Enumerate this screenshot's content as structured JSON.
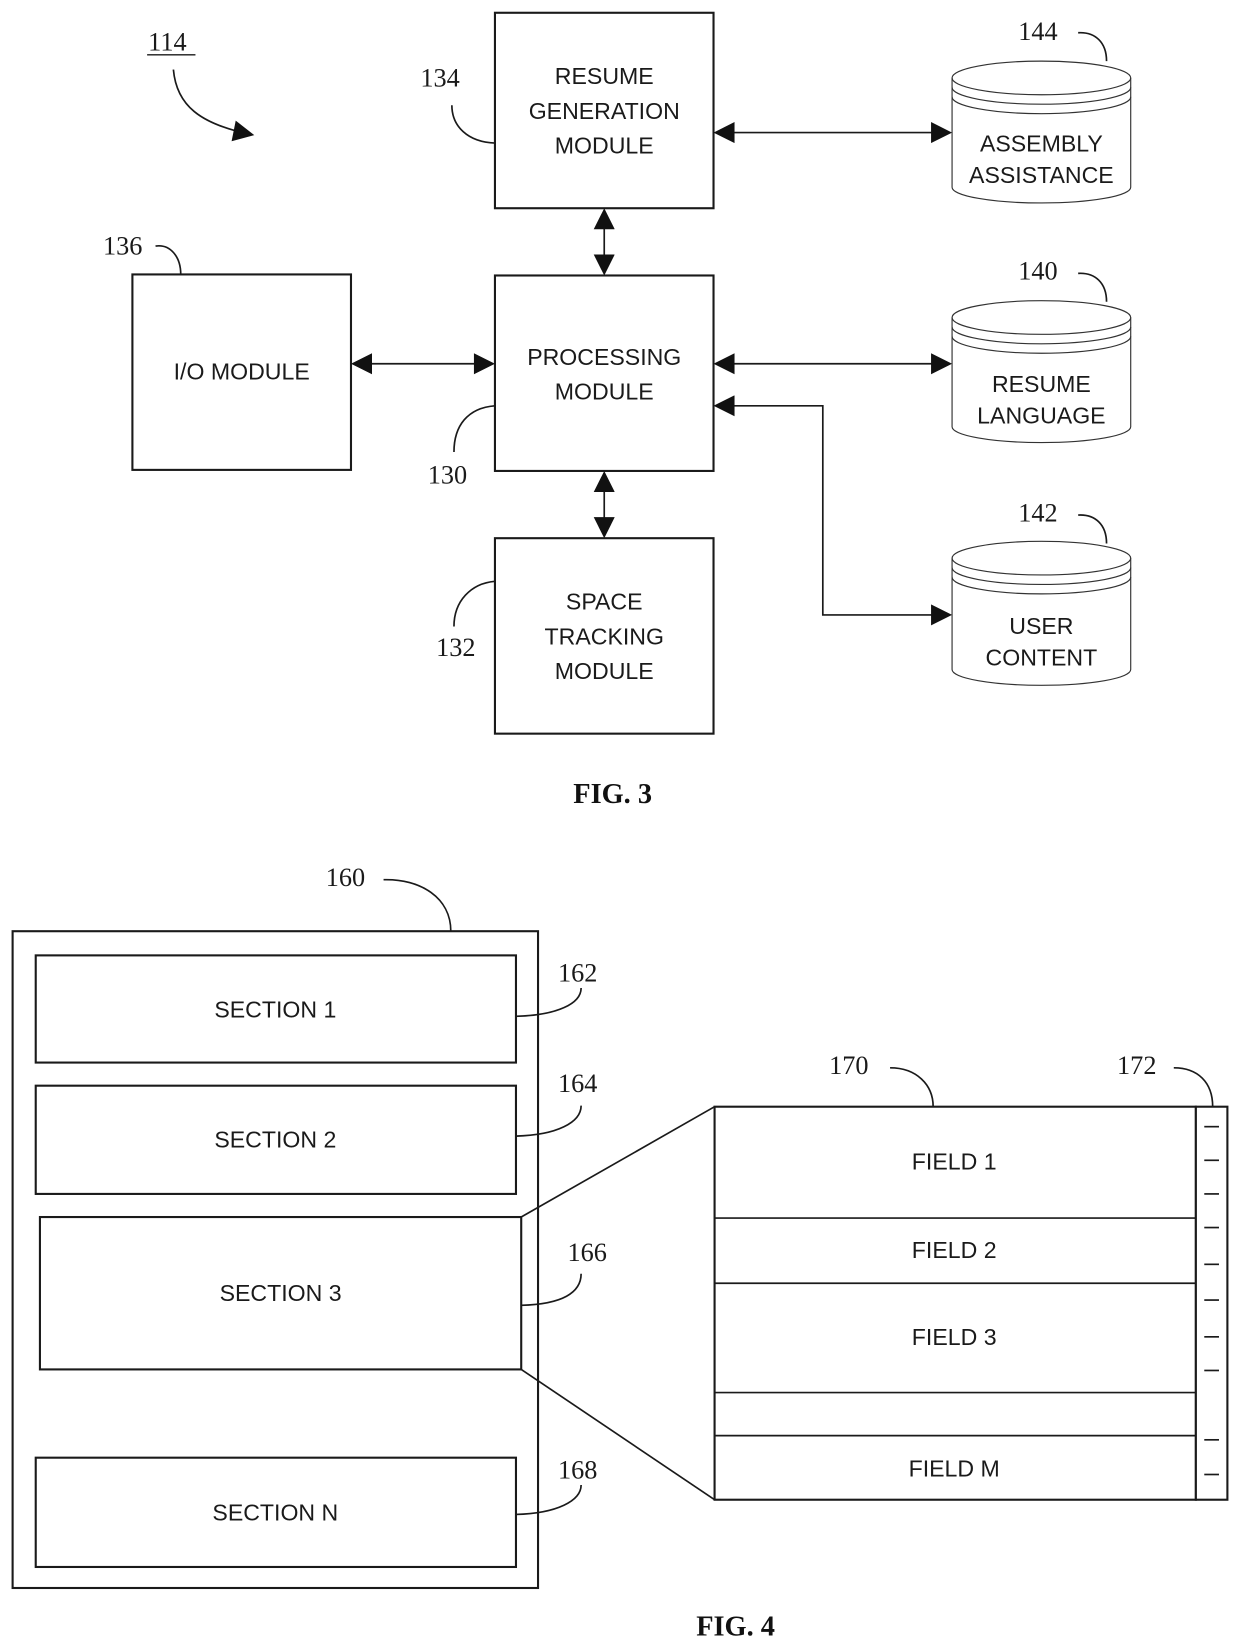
{
  "fig3": {
    "caption": "FIG. 3",
    "system_ref": "114",
    "modules": {
      "resume_generation": {
        "ref": "134",
        "lines": [
          "RESUME",
          "GENERATION",
          "MODULE"
        ]
      },
      "io": {
        "ref": "136",
        "lines": [
          "I/O MODULE"
        ]
      },
      "processing": {
        "ref": "130",
        "lines": [
          "PROCESSING",
          "MODULE"
        ]
      },
      "space_tracking": {
        "ref": "132",
        "lines": [
          "SPACE",
          "TRACKING",
          "MODULE"
        ]
      }
    },
    "databases": {
      "assembly_assistance": {
        "ref": "144",
        "lines": [
          "ASSEMBLY",
          "ASSISTANCE"
        ]
      },
      "resume_language": {
        "ref": "140",
        "lines": [
          "RESUME",
          "LANGUAGE"
        ]
      },
      "user_content": {
        "ref": "142",
        "lines": [
          "USER",
          "CONTENT"
        ]
      }
    },
    "connections": [
      {
        "from": "resume_generation",
        "to": "assembly_assistance",
        "type": "bidirectional"
      },
      {
        "from": "resume_generation",
        "to": "processing",
        "type": "bidirectional"
      },
      {
        "from": "io",
        "to": "processing",
        "type": "bidirectional"
      },
      {
        "from": "processing",
        "to": "resume_language",
        "type": "bidirectional"
      },
      {
        "from": "processing",
        "to": "user_content",
        "type": "bidirectional"
      },
      {
        "from": "processing",
        "to": "space_tracking",
        "type": "bidirectional"
      }
    ]
  },
  "fig4": {
    "caption": "FIG. 4",
    "document_ref": "160",
    "sections": [
      {
        "ref": "162",
        "label": "SECTION 1"
      },
      {
        "ref": "164",
        "label": "SECTION 2"
      },
      {
        "ref": "166",
        "label": "SECTION 3"
      },
      {
        "ref": "168",
        "label": "SECTION N"
      }
    ],
    "field_panel_ref": "170",
    "ruler_ref": "172",
    "fields": [
      {
        "label": "FIELD 1"
      },
      {
        "label": "FIELD 2"
      },
      {
        "label": "FIELD 3"
      },
      {
        "label": ""
      },
      {
        "label": "FIELD M"
      }
    ]
  }
}
